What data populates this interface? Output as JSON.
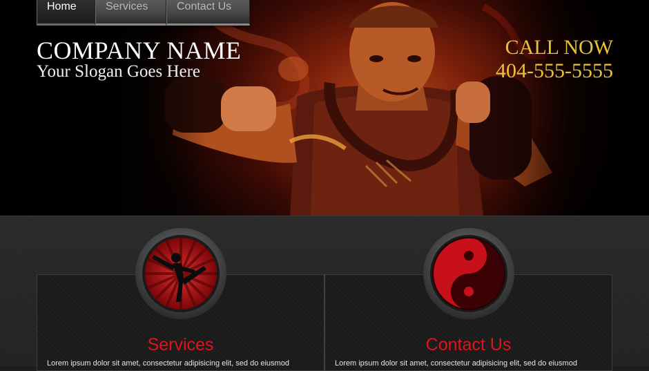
{
  "nav": {
    "items": [
      {
        "label": "Home",
        "active": true
      },
      {
        "label": "Services",
        "active": false
      },
      {
        "label": "Contact Us",
        "active": false
      }
    ]
  },
  "header": {
    "company_name": "COMPANY NAME",
    "slogan": "Your Slogan Goes Here",
    "call_now": "CALL NOW",
    "phone": "404-555-5555"
  },
  "panels": [
    {
      "title": "Services",
      "icon": "martial-artist-kick-icon",
      "text": "Lorem ipsum dolor sit amet, consectetur adipisicing elit, sed do eiusmod"
    },
    {
      "title": "Contact Us",
      "icon": "yin-yang-icon",
      "text": "Lorem ipsum dolor sit amet, consectetur adipisicing elit, sed do eiusmod"
    }
  ],
  "colors": {
    "accent_red": "#e1141b",
    "call_gold": "#e8c23a",
    "background": "#1e1e1e"
  }
}
